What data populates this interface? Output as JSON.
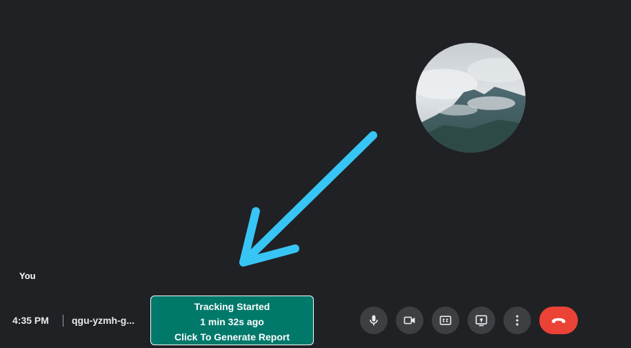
{
  "self_tile": {
    "name_label": "You",
    "avatar_icon": "mountain-photo-avatar"
  },
  "bottom_bar": {
    "time": "4:35 PM",
    "meeting_code": "qgu-yzmh-g..."
  },
  "tracking": {
    "line1": "Tracking Started",
    "line2": "1 min 32s ago",
    "line3": "Click To Generate Report",
    "background_color": "#00796b"
  },
  "controls": [
    {
      "icon": "microphone-icon",
      "state": "on"
    },
    {
      "icon": "camera-icon",
      "state": "on"
    },
    {
      "icon": "closed-captions-icon",
      "state": "off"
    },
    {
      "icon": "present-screen-icon",
      "state": "off"
    },
    {
      "icon": "more-options-icon"
    },
    {
      "icon": "hang-up-icon",
      "color": "#ea4335"
    }
  ],
  "annotation": {
    "icon": "pointing-arrow",
    "color": "#37c5f5"
  },
  "colors": {
    "background": "#202124",
    "control_button": "#3c4043",
    "hang_up": "#ea4335"
  }
}
